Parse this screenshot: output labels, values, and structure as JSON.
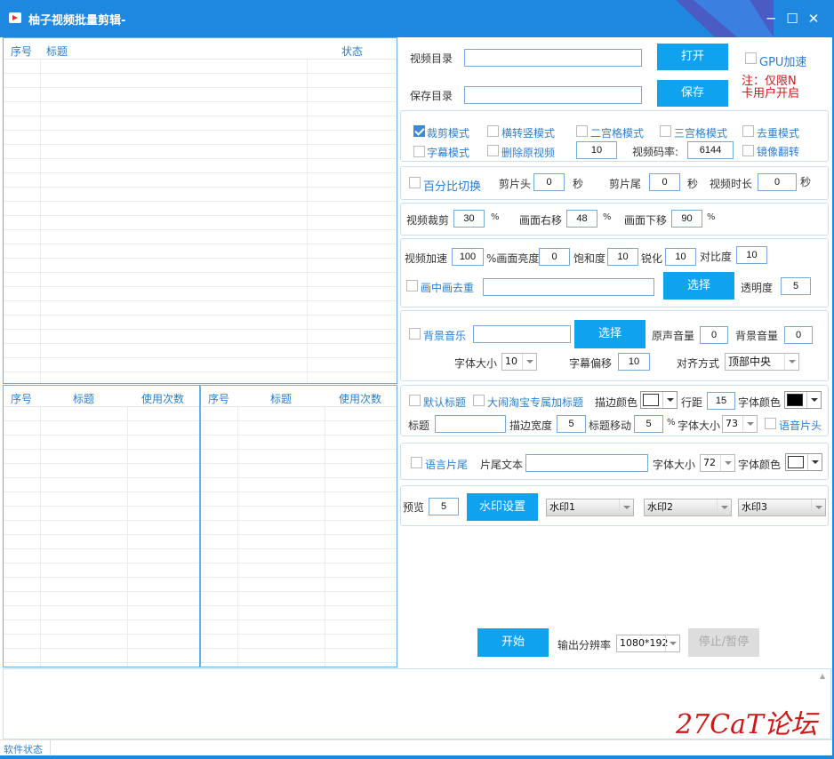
{
  "window": {
    "title": "柚子视频批量剪辑-",
    "controls": {
      "minimize": "─",
      "maximize": "☐",
      "close": "✕"
    }
  },
  "main_list": {
    "columns": [
      "序号",
      "标题",
      "状态"
    ]
  },
  "bottom_lists": {
    "left_columns": [
      "序号",
      "标题",
      "使用次数"
    ],
    "right_columns": [
      "序号",
      "标题",
      "使用次数"
    ]
  },
  "paths": {
    "video_dir_label": "视频目录",
    "video_dir_value": "",
    "open_button": "打开",
    "save_dir_label": "保存目录",
    "save_dir_value": "",
    "save_button": "保存",
    "gpu_label": "GPU加速",
    "gpu_note_line1": "注：仅限N",
    "gpu_note_line2": "卡用户开启"
  },
  "modes": {
    "crop_mode": "裁剪模式",
    "landscape_portrait": "横转竖模式",
    "two_grid": "二宫格模式",
    "three_grid": "三宫格模式",
    "dedup_mode": "去重模式",
    "subtitle_mode": "字幕模式",
    "delete_source": "删除原视频",
    "count_value": "10",
    "bitrate_label": "视频码率:",
    "bitrate_value": "6144",
    "mirror_flip": "镜像翻转"
  },
  "trim": {
    "percent_switch": "百分比切换",
    "head_label": "剪片头",
    "head_value": "0",
    "head_unit": "秒",
    "tail_label": "剪片尾",
    "tail_value": "0",
    "tail_unit": "秒",
    "duration_label": "视频时长",
    "duration_value": "0",
    "duration_unit": "秒"
  },
  "crop": {
    "crop_label": "视频裁剪",
    "crop_value": "30",
    "crop_unit": "%",
    "right_label": "画面右移",
    "right_value": "48",
    "right_unit": "%",
    "down_label": "画面下移",
    "down_value": "90",
    "down_unit": "%"
  },
  "effects": {
    "speed_label": "视频加速",
    "speed_value": "100",
    "brightness_label": "%画面亮度",
    "brightness_value": "0",
    "saturation_label": "饱和度",
    "saturation_value": "10",
    "sharpen_label": "锐化",
    "sharpen_value": "10",
    "contrast_label": "对比度",
    "contrast_value": "10",
    "pip_label": "画中画去重",
    "pip_value": "",
    "pip_button": "选择",
    "opacity_label": "透明度",
    "opacity_value": "5"
  },
  "music": {
    "bgm_label": "背景音乐",
    "bgm_value": "",
    "select_button": "选择",
    "orig_volume_label": "原声音量",
    "orig_volume_value": "0",
    "bgm_volume_label": "背景音量",
    "bgm_volume_value": "0",
    "font_size_label": "字体大小",
    "font_size_value": "10",
    "subtitle_offset_label": "字幕偏移",
    "subtitle_offset_value": "10",
    "align_label": "对齐方式",
    "align_value": "顶部中央"
  },
  "title_opts": {
    "default_title": "默认标题",
    "taobao_title": "大闹淘宝专属加标题",
    "stroke_color_label": "描边颜色",
    "stroke_color": "#ffffff",
    "line_spacing_label": "行距",
    "line_spacing_value": "15",
    "font_color_label": "字体颜色",
    "font_color": "#000000",
    "title_label": "标题",
    "title_value": "",
    "stroke_width_label": "描边宽度",
    "stroke_width_value": "5",
    "title_move_label": "标题移动",
    "title_move_value": "5",
    "title_move_unit": "%",
    "font_size_label": "字体大小",
    "font_size_value": "73",
    "voice_head": "语音片头"
  },
  "outro": {
    "voice_tail": "语言片尾",
    "outro_text_label": "片尾文本",
    "outro_text_value": "",
    "font_size_label": "字体大小",
    "font_size_value": "72",
    "font_color_label": "字体颜色",
    "font_color": "#ffffff"
  },
  "watermark": {
    "preview_label": "预览",
    "preview_value": "5",
    "settings_button": "水印设置",
    "wm1": "水印1",
    "wm2": "水印2",
    "wm3": "水印3"
  },
  "run": {
    "start_button": "开始",
    "resolution_label": "输出分辨率",
    "resolution_value": "1080*192",
    "stop_button": "停止/暂停"
  },
  "status": {
    "label": "软件状态",
    "overlay": "27CaT论坛"
  },
  "colors": {
    "accent": "#1e88e0",
    "button": "#0ea2ef",
    "label_blue": "#2b7fd2",
    "note_red": "#d01818"
  }
}
